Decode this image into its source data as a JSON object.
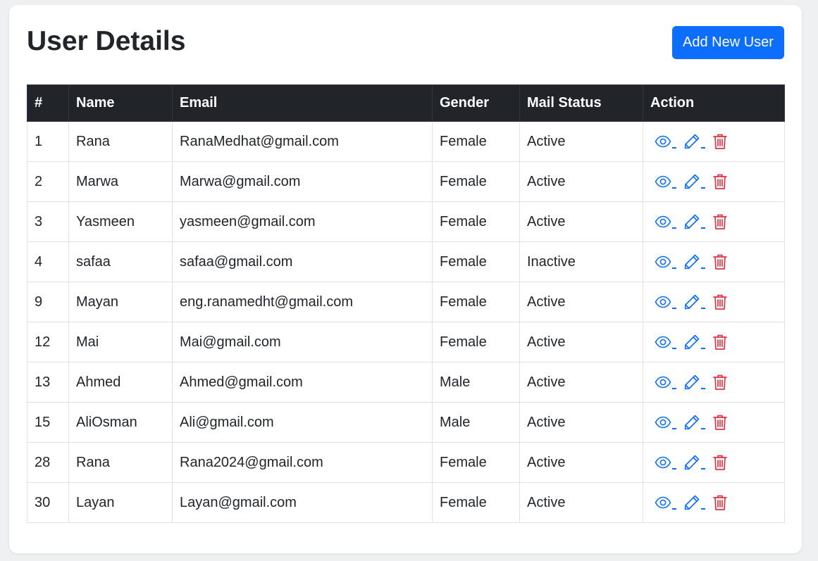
{
  "page": {
    "title": "User Details",
    "add_button_label": "Add New User"
  },
  "colors": {
    "primary": "#0d6efd",
    "danger": "#dc3545",
    "header_bg": "#212529"
  },
  "table": {
    "columns": [
      "#",
      "Name",
      "Email",
      "Gender",
      "Mail Status",
      "Action"
    ],
    "rows": [
      {
        "id": "1",
        "name": "Rana",
        "email": "RanaMedhat@gmail.com",
        "gender": "Female",
        "status": "Active"
      },
      {
        "id": "2",
        "name": "Marwa",
        "email": "Marwa@gmail.com",
        "gender": "Female",
        "status": "Active"
      },
      {
        "id": "3",
        "name": "Yasmeen",
        "email": "yasmeen@gmail.com",
        "gender": "Female",
        "status": "Active"
      },
      {
        "id": "4",
        "name": "safaa",
        "email": "safaa@gmail.com",
        "gender": "Female",
        "status": "Inactive"
      },
      {
        "id": "9",
        "name": "Mayan",
        "email": "eng.ranamedht@gmail.com",
        "gender": "Female",
        "status": "Active"
      },
      {
        "id": "12",
        "name": "Mai",
        "email": "Mai@gmail.com",
        "gender": "Female",
        "status": "Active"
      },
      {
        "id": "13",
        "name": "Ahmed",
        "email": "Ahmed@gmail.com",
        "gender": "Male",
        "status": "Active"
      },
      {
        "id": "15",
        "name": "AliOsman",
        "email": "Ali@gmail.com",
        "gender": "Male",
        "status": "Active"
      },
      {
        "id": "28",
        "name": "Rana",
        "email": "Rana2024@gmail.com",
        "gender": "Female",
        "status": "Active"
      },
      {
        "id": "30",
        "name": "Layan",
        "email": "Layan@gmail.com",
        "gender": "Female",
        "status": "Active"
      }
    ],
    "row_actions": [
      "eye-icon",
      "pencil-icon",
      "trash-icon"
    ]
  }
}
